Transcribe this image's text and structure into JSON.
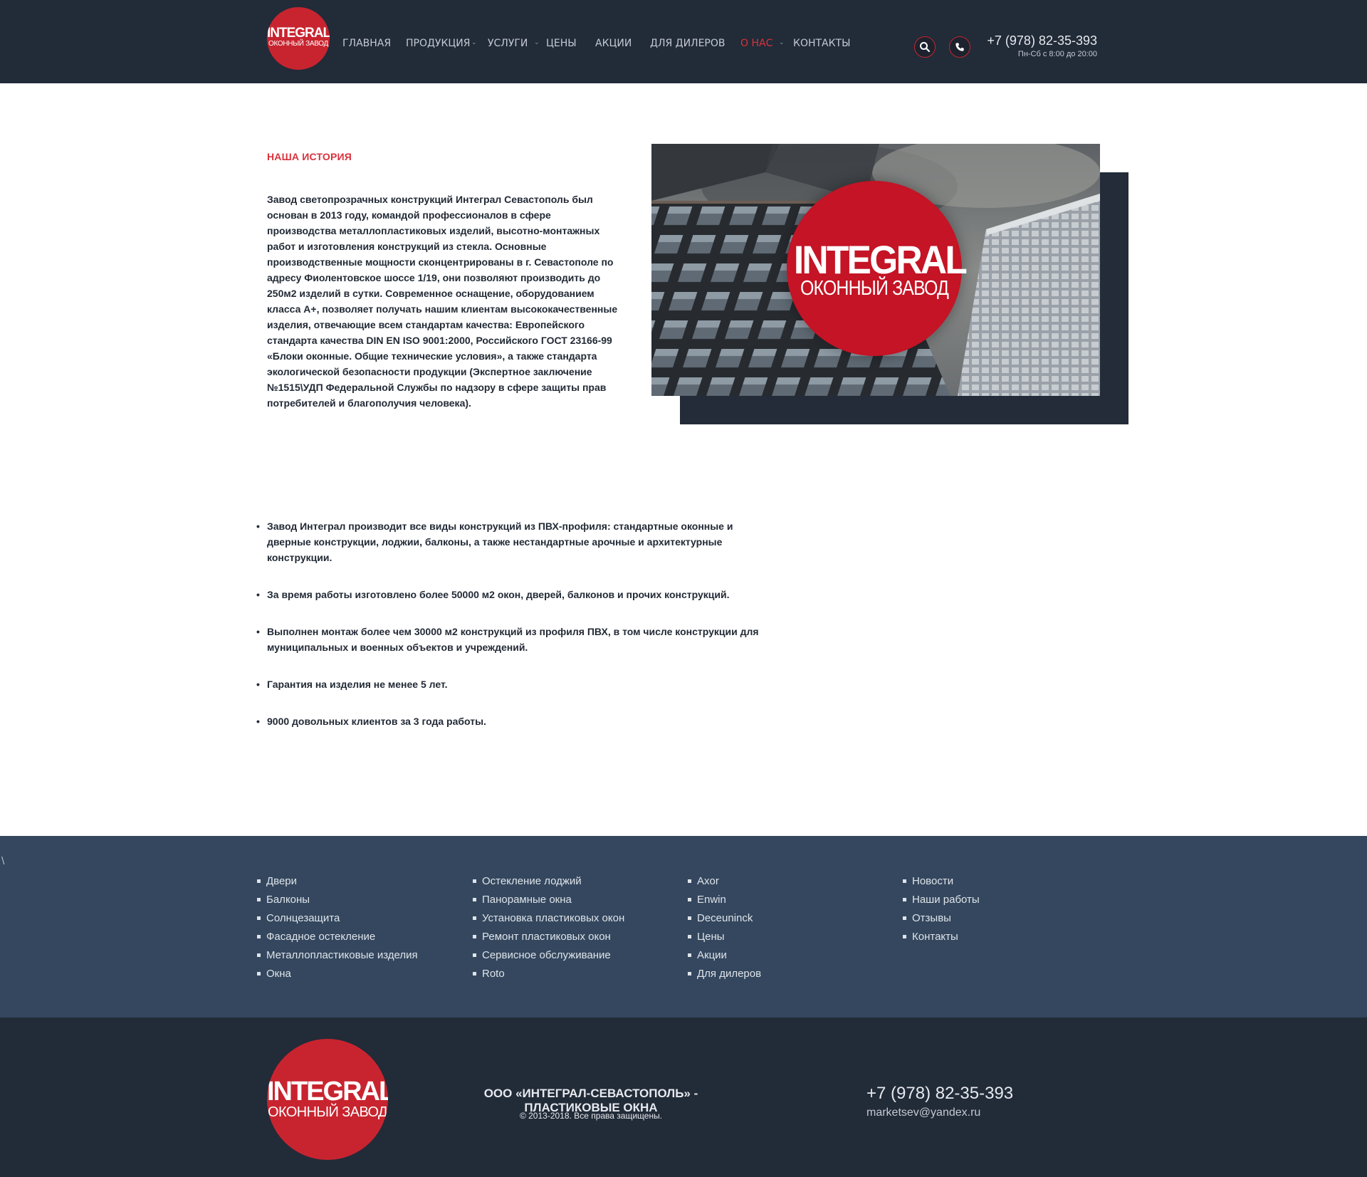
{
  "logo": {
    "line1": "INTEGRAL",
    "line2": "ОКОННЫЙ ЗАВОД"
  },
  "nav": {
    "items": [
      {
        "label": "ГЛАВНАЯ"
      },
      {
        "label": "ПРОДУКЦИЯ"
      },
      {
        "label": "УСЛУГИ"
      },
      {
        "label": "ЦЕНЫ"
      },
      {
        "label": "АКЦИИ"
      },
      {
        "label": "ДЛЯ ДИЛЕРОВ"
      },
      {
        "label": "О НАС"
      },
      {
        "label": "КОНТАКТЫ"
      }
    ],
    "caret": "⌄",
    "active": "О НАС"
  },
  "header": {
    "phone": "+7 (978) 82-35-393",
    "hours": "Пн-Сб с 8:00 до 20:00",
    "search_icon": "search-icon",
    "phone_icon": "phone-icon"
  },
  "about": {
    "title": "НАША ИСТОРИЯ",
    "text": "Завод светопрозрачных конструкций Интеграл Севастополь был основан в 2013 году, командой профессионалов в сфере производства металлопластиковых изделий, высотно-монтажных работ и изготовления конструкций из стекла. Основные производственные мощности сконцентрированы в г. Севастополе по адресу Фиолентовское шоссе 1/19, они позволяют производить до 250м2 изделий в сутки. Современное оснащение, оборудованием класса А+, позволяет получать нашим клиентам высококачественные изделия, отвечающие всем стандартам качества: Европейского стандарта качества DIN EN ISO 9001:2000, Российского ГОСТ 23166-99 «Блоки оконные. Общие технические условия», а также стандарта экологической безопасности продукции (Экспертное заключение №1515\\УДП Федеральной Службы по надзору в сфере защиты прав потребителей и благополучия человека)."
  },
  "facts": [
    "Завод Интеграл производит все виды конструкций из ПВХ-профиля: стандартные оконные и дверные конструкции, лоджии, балконы, а также нестандартные арочные и архитектурные конструкции.",
    "За время работы изготовлено более 50000 м2 окон, дверей, балконов и прочих конструкций.",
    "Выполнен монтаж более чем 30000 м2 конструкций из профиля ПВХ, в том числе конструкции для муниципальных и военных объектов и учреждений.",
    "Гарантия на изделия не менее 5 лет.",
    "9000 довольных клиентов за 3 года работы."
  ],
  "footer_links": {
    "stray_char": "\\",
    "col1": [
      "Двери",
      "Балконы",
      "Солнцезащита",
      "Фасадное остекление",
      "Металлопластиковые изделия",
      "Окна"
    ],
    "col2": [
      "Остекление лоджий",
      "Панорамные окна",
      "Установка пластиковых окон",
      "Ремонт пластиковых окон",
      "Сервисное обслуживание",
      "Roto"
    ],
    "col3": [
      "Axor",
      "Enwin",
      "Deceuninck",
      "Цены",
      "Акции",
      "Для дилеров"
    ],
    "col4": [
      "Новости",
      "Наши работы",
      "Отзывы",
      "Контакты"
    ]
  },
  "footer": {
    "company": "ООО «ИНТЕГРАЛ-СЕВАСТОПОЛЬ» - ПЛАСТИКОВЫЕ ОКНА",
    "copyright": "© 2013-2018. Все права защищены.",
    "phone": "+7 (978) 82-35-393",
    "email": "marketsev@yandex.ru"
  },
  "colors": {
    "header_bg": "#222b38",
    "accent_red": "#c8242f",
    "footer_links_bg": "#34475e",
    "footer_bottom_bg": "#222b38"
  }
}
